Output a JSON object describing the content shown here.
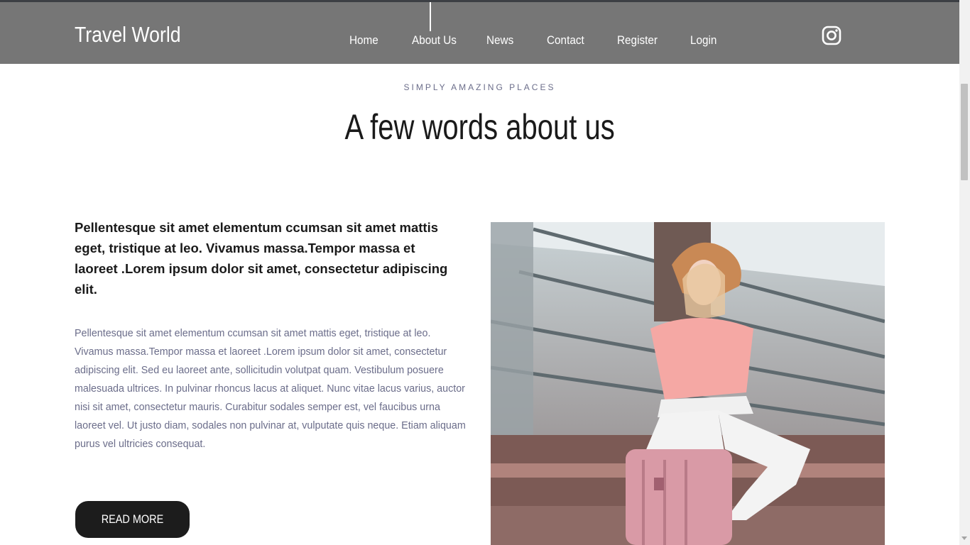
{
  "header": {
    "logo": "Travel World",
    "nav": [
      {
        "label": "Home"
      },
      {
        "label": "About Us"
      },
      {
        "label": "News"
      },
      {
        "label": "Contact"
      },
      {
        "label": "Register"
      },
      {
        "label": "Login"
      }
    ],
    "active_item": "About Us",
    "social_icon": "instagram-icon"
  },
  "about": {
    "eyebrow": "SIMPLY AMAZING PLACES",
    "title": "A few words about us",
    "lead": "Pellentesque sit amet elementum ccumsan sit amet mattis eget, tristique at leo. Vivamus massa.Tempor massa et laoreet .Lorem ipsum dolor sit amet, consectetur adipiscing elit.",
    "body": "Pellentesque sit amet elementum ccumsan sit amet mattis eget, tristique at leo. Vivamus massa.Tempor massa et laoreet .Lorem ipsum dolor sit amet, consectetur adipiscing elit. Sed eu laoreet ante, sollicitudin volutpat quam. Vestibulum posuere malesuada ultrices. In pulvinar rhoncus lacus at aliquet. Nunc vitae lacus varius, auctor nisi sit amet, consectetur mauris. Curabitur sodales semper est, vel faucibus urna laoreet vel. Ut justo diam, sodales non pulvinar at, vulputate quis neque. Etiam aliquam purus vel ultricies consequat.",
    "button_label": "READ MORE"
  },
  "colors": {
    "header_bg": "#767676",
    "button_bg": "#1c1c1c",
    "muted_text": "#6b6d8a"
  }
}
